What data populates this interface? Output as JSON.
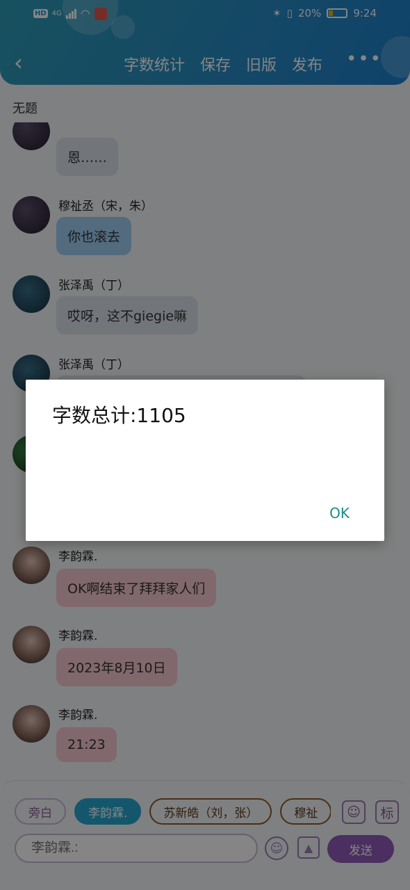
{
  "status_bar": {
    "network": "4G",
    "hd": "HD",
    "battery": "20%",
    "time": "9:24"
  },
  "nav": {
    "actions": [
      "字数统计",
      "保存",
      "旧版",
      "发布"
    ],
    "more": "•••"
  },
  "doc_title": "无题",
  "messages": [
    {
      "sender": "",
      "text": "恩……",
      "bubble": "gray"
    },
    {
      "sender": "穆祉丞（宋，朱）",
      "text": "你也滚去",
      "bubble": "blue"
    },
    {
      "sender": "张泽禹（丁）",
      "text": "哎呀，这不giegie嘛",
      "bubble": "gray"
    },
    {
      "sender": "张泽禹（丁）",
      "text": "",
      "bubble": "gray"
    },
    {
      "sender": "李韵霖.",
      "text": "OK啊结束了拜拜家人们",
      "bubble": "pink"
    },
    {
      "sender": "李韵霖.",
      "text": "2023年8月10日",
      "bubble": "pink"
    },
    {
      "sender": "李韵霖.",
      "text": "21:23",
      "bubble": "pink"
    }
  ],
  "dialog": {
    "message": "字数总计:1105",
    "ok": "OK"
  },
  "bottom": {
    "chips": [
      "旁白",
      "李韵霖.",
      "苏新皓（刘，张）",
      "穆祉"
    ],
    "tag_icon_label": "标",
    "input_placeholder": "李韵霖.:",
    "send": "发送"
  }
}
